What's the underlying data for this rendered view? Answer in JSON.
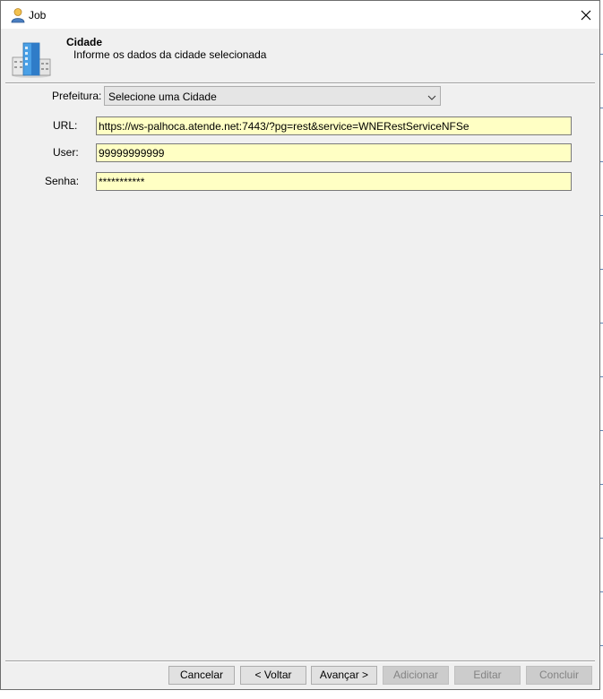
{
  "window": {
    "title": "Job",
    "icon": "user-icon"
  },
  "header": {
    "title": "Cidade",
    "subtitle": "Informe os dados da cidade selecionada",
    "icon": "buildings-icon"
  },
  "form": {
    "prefeitura": {
      "label": "Prefeitura:",
      "selected": "Selecione uma Cidade"
    },
    "url": {
      "label": "URL:",
      "value": "https://ws-palhoca.atende.net:7443/?pg=rest&service=WNERestServiceNFSe"
    },
    "user": {
      "label": "User:",
      "value": "99999999999"
    },
    "senha": {
      "label": "Senha:",
      "value": "***********"
    }
  },
  "buttons": {
    "cancelar": "Cancelar",
    "voltar": "< Voltar",
    "avancar": "Avançar >",
    "adicionar": "Adicionar",
    "editar": "Editar",
    "concluir": "Concluir"
  },
  "colors": {
    "field_background": "#ffffc4",
    "window_background": "#f0f0f0"
  }
}
